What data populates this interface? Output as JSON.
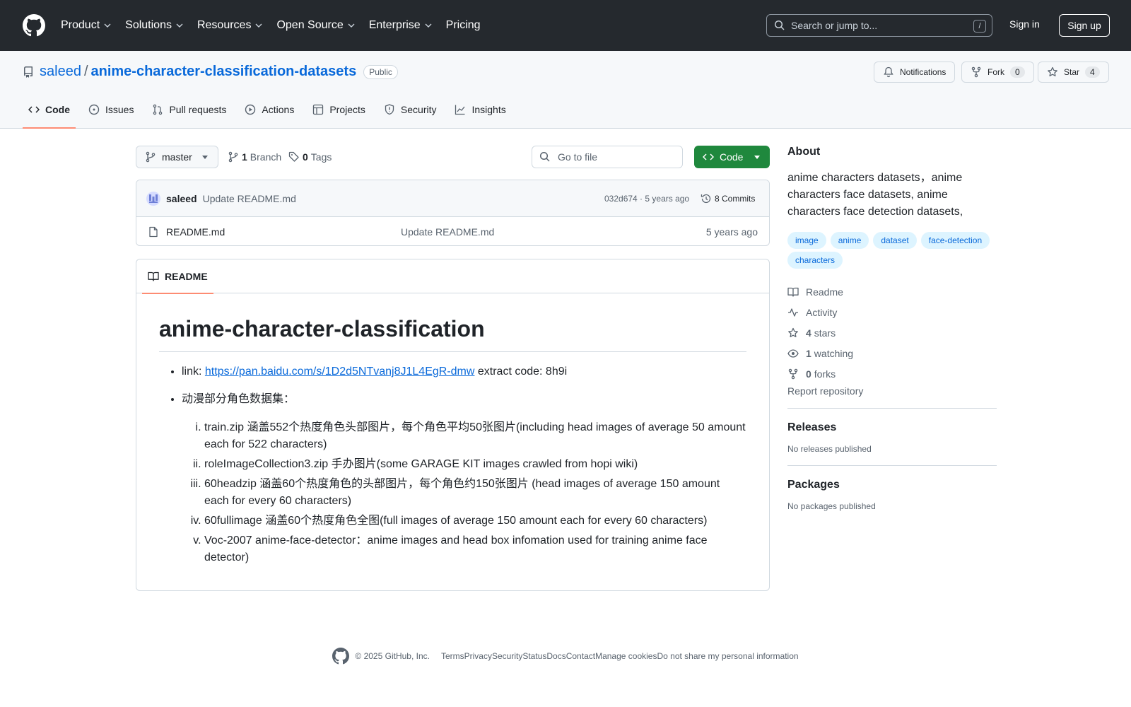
{
  "header": {
    "nav": [
      "Product",
      "Solutions",
      "Resources",
      "Open Source",
      "Enterprise",
      "Pricing"
    ],
    "search_placeholder": "Search or jump to...",
    "search_shortcut": "/",
    "sign_in": "Sign in",
    "sign_up": "Sign up"
  },
  "repo": {
    "owner": "saleed",
    "separator": "/",
    "name": "anime-character-classification-datasets",
    "visibility": "Public",
    "notifications_label": "Notifications",
    "fork_label": "Fork",
    "fork_count": "0",
    "star_label": "Star",
    "star_count": "4"
  },
  "tabs": [
    "Code",
    "Issues",
    "Pull requests",
    "Actions",
    "Projects",
    "Security",
    "Insights"
  ],
  "toolbar": {
    "branch": "master",
    "branch_count": "1",
    "branch_label": "Branch",
    "tag_count": "0",
    "tag_label": "Tags",
    "goto_placeholder": "Go to file",
    "code_button": "Code"
  },
  "commit": {
    "author": "saleed",
    "message": "Update README.md",
    "hash_time": "032d674 · 5 years ago",
    "commits_label": "8 Commits"
  },
  "files": [
    {
      "name": "README.md",
      "message": "Update README.md",
      "age": "5 years ago"
    }
  ],
  "readme": {
    "tab_label": "README",
    "title": "anime-character-classification",
    "link_prefix": "link: ",
    "link_url": "https://pan.baidu.com/s/1D2d5NTvanj8J1L4EgR-dmw",
    "link_suffix": " extract code: 8h9i",
    "dataset_intro": "动漫部分角色数据集：",
    "items": [
      "train.zip 涵盖552个热度角色头部图片，每个角色平均50张图片(including head images of average 50 amount each for 522 characters)",
      "roleImageCollection3.zip 手办图片(some GARAGE KIT images crawled from hopi wiki)",
      "60headzip 涵盖60个热度角色的头部图片，每个角色约150张图片 (head images of average 150 amount each for every 60 characters)",
      "60fullimage 涵盖60个热度角色全图(full images of average 150 amount each for every 60 characters)",
      "Voc-2007 anime-face-detector：anime images and head box infomation used for training anime face detector)"
    ]
  },
  "about": {
    "heading": "About",
    "description": "anime characters datasets，anime characters face datasets, anime characters face detection datasets,",
    "topics": [
      "image",
      "anime",
      "dataset",
      "face-detection",
      "characters"
    ],
    "readme": "Readme",
    "activity": "Activity",
    "stars_count": "4",
    "stars_label": "stars",
    "watching_count": "1",
    "watching_label": "watching",
    "forks_count": "0",
    "forks_label": "forks",
    "report": "Report repository"
  },
  "releases": {
    "heading": "Releases",
    "text": "No releases published"
  },
  "packages": {
    "heading": "Packages",
    "text": "No packages published"
  },
  "footer": [
    "© 2025 GitHub, Inc.",
    "Terms",
    "Privacy",
    "Security",
    "Status",
    "Docs",
    "Contact",
    "Manage cookies",
    "Do not share my personal information"
  ]
}
